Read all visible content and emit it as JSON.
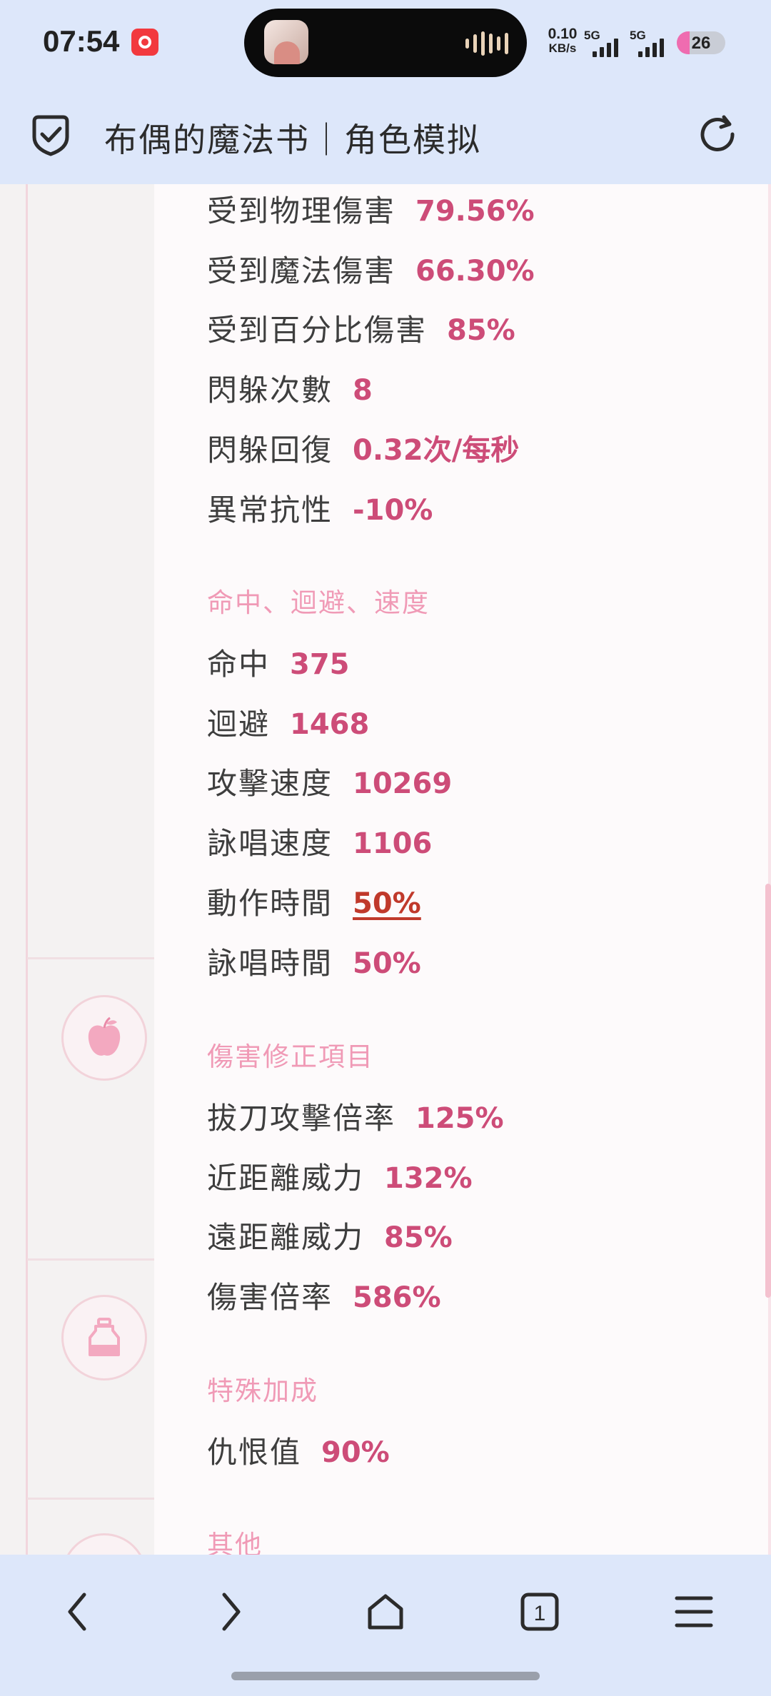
{
  "status_bar": {
    "time": "07:54",
    "net_speed_value": "0.10",
    "net_speed_unit": "KB/s",
    "signal1_label": "5G",
    "signal2_label": "5G",
    "battery_level": "26",
    "battery_fraction": 0.26
  },
  "header": {
    "title": "布偶的魔法书｜角色模拟",
    "shield_icon": "shield-check-icon",
    "reload_icon": "reload-icon"
  },
  "stats": {
    "rows_a": [
      {
        "label": "受到物理傷害",
        "value": "79.56%"
      },
      {
        "label": "受到魔法傷害",
        "value": "66.30%"
      },
      {
        "label": "受到百分比傷害",
        "value": "85%"
      },
      {
        "label": "閃躲次數",
        "value": "8"
      },
      {
        "label": "閃躲回復",
        "value": "0.32次/每秒"
      },
      {
        "label": "異常抗性",
        "value": "-10%"
      }
    ],
    "section_b": "命中、迴避、速度",
    "rows_b": [
      {
        "label": "命中",
        "value": "375"
      },
      {
        "label": "迴避",
        "value": "1468"
      },
      {
        "label": "攻擊速度",
        "value": "10269"
      },
      {
        "label": "詠唱速度",
        "value": "1106"
      },
      {
        "label": "動作時間",
        "value": "50%"
      },
      {
        "label": "詠唱時間",
        "value": "50%"
      }
    ],
    "section_c": "傷害修正項目",
    "rows_c": [
      {
        "label": "拔刀攻擊倍率",
        "value": "125%"
      },
      {
        "label": "近距離威力",
        "value": "132%"
      },
      {
        "label": "遠距離威力",
        "value": "85%"
      },
      {
        "label": "傷害倍率",
        "value": "586%"
      }
    ],
    "section_d": "特殊加成",
    "rows_d": [
      {
        "label": "仇恨值",
        "value": "90%"
      }
    ],
    "section_e": "其他"
  },
  "rail_icons": [
    "apple-icon",
    "potion-bottle-icon",
    "circle-icon"
  ],
  "colors": {
    "accent_value": "#cd4c78",
    "section_title": "#f09ab6",
    "link_value": "#c0392b",
    "bar_bg": "#dde7fa"
  },
  "bottom_nav": {
    "tab_count": "1",
    "icons": [
      "back-icon",
      "forward-icon",
      "home-icon",
      "tabs-icon",
      "menu-icon"
    ]
  }
}
